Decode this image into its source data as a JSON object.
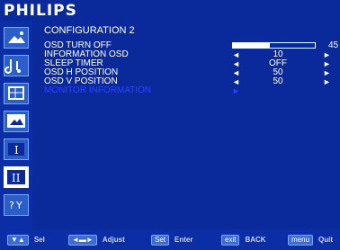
{
  "brand": "PHILIPS",
  "sidebar": {
    "items": [
      {
        "name": "picture-icon",
        "active": false
      },
      {
        "name": "audio-icon",
        "active": false
      },
      {
        "name": "general-settings-icon",
        "active": false
      },
      {
        "name": "screen-icon",
        "active": false
      },
      {
        "name": "configuration-1-icon",
        "active": false
      },
      {
        "name": "configuration-2-icon",
        "active": true
      },
      {
        "name": "advanced-option-icon",
        "active": false
      }
    ]
  },
  "menu": {
    "title": "CONFIGURATION 2",
    "osd_turn_off": {
      "label": "OSD TURN OFF",
      "value": "45",
      "fraction": 0.45
    },
    "information_osd": {
      "label": "INFORMATION OSD",
      "value": "10"
    },
    "sleep_timer": {
      "label": "SLEEP TIMER",
      "value": "OFF"
    },
    "osd_h_position": {
      "label": "OSD H POSITION",
      "value": "50"
    },
    "osd_v_position": {
      "label": "OSD V POSITION",
      "value": "50"
    },
    "monitor_information": {
      "label": "MONITOR INFORMATION"
    }
  },
  "footer": {
    "sel_key": "▼▲",
    "sel_label": "Sel",
    "adjust_key": "◄▬►",
    "adjust_label": "Adjust",
    "enter_key": "Set",
    "enter_label": "Enter",
    "back_key": "exit",
    "back_label": "BACK",
    "quit_key": "menu",
    "quit_label": "Quit"
  },
  "colors": {
    "background": "#0a2a9c",
    "highlight": "#2a43ff",
    "text": "#ffffff"
  }
}
